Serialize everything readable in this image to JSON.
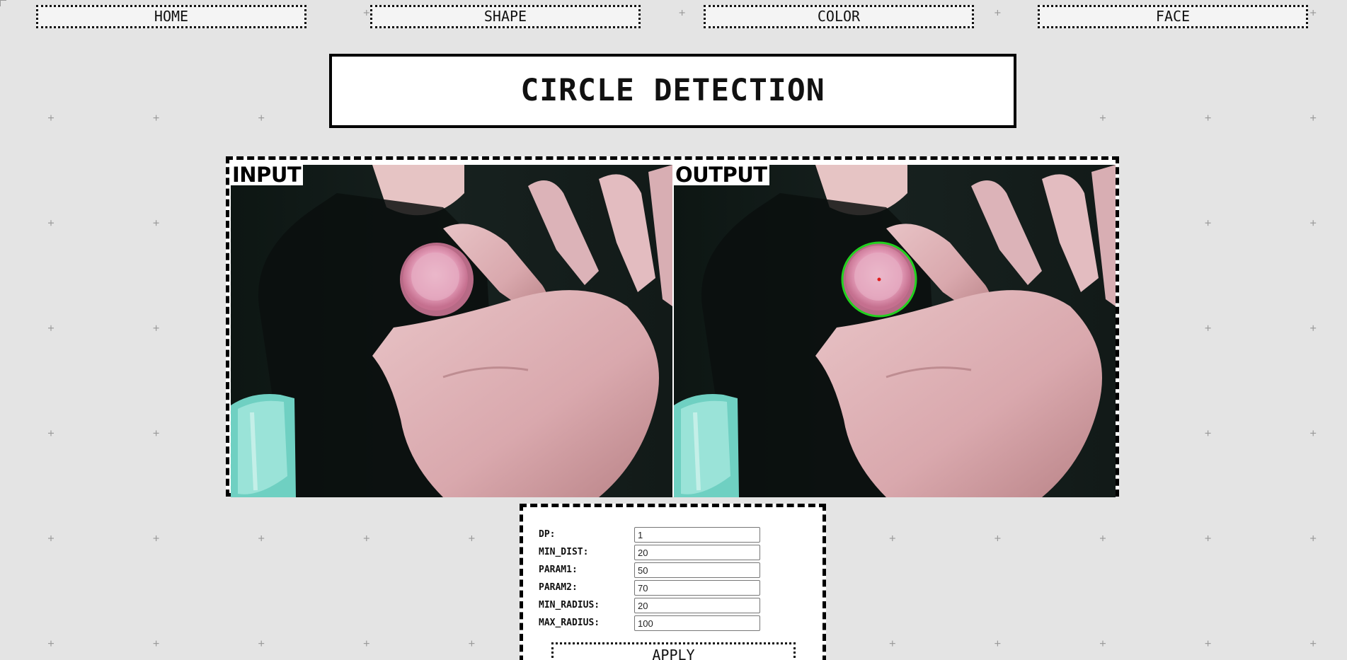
{
  "nav": {
    "home_label": "HOME",
    "shape_label": "SHAPE",
    "color_label": "COLOR",
    "face_label": "FACE"
  },
  "page_title": "CIRCLE DETECTION",
  "viewer": {
    "input_label": "INPUT",
    "output_label": "OUTPUT"
  },
  "params": {
    "dp": {
      "label": "DP:",
      "value": "1"
    },
    "min_dist": {
      "label": "MIN_DIST:",
      "value": "20"
    },
    "param1": {
      "label": "PARAM1:",
      "value": "50"
    },
    "param2": {
      "label": "PARAM2:",
      "value": "70"
    },
    "min_radius": {
      "label": "MIN_RADIUS:",
      "value": "20"
    },
    "max_radius": {
      "label": "MAX_RADIUS:",
      "value": "100"
    }
  },
  "apply_label": "APPLY",
  "colors": {
    "background": "#e4e4e4",
    "grid_cross": "#9a9a9a",
    "detected_circle": "#22d11f",
    "detected_center": "#e01a1a"
  }
}
